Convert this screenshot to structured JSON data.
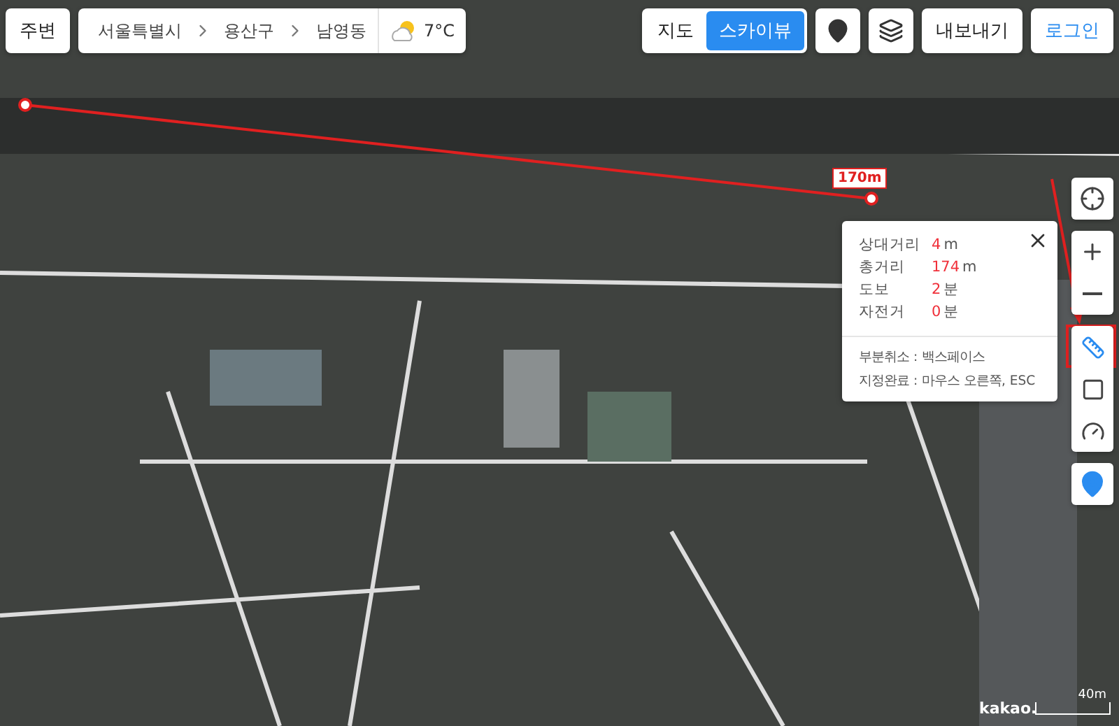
{
  "top_bar": {
    "nearby_button": "주변",
    "breadcrumb": [
      "서울특별시",
      "용산구",
      "남영동"
    ],
    "weather": {
      "temperature": "7°C"
    }
  },
  "map_types": [
    {
      "label": "지도",
      "selected": false
    },
    {
      "label": "스카이뷰",
      "selected": true
    }
  ],
  "export_button": "내보내기",
  "login_button": "로그인",
  "measure": {
    "segment_label": "170m",
    "rows": [
      {
        "label": "상대거리",
        "value": "4",
        "unit": "m"
      },
      {
        "label": "총거리",
        "value": "174",
        "unit": "m"
      },
      {
        "label": "도보",
        "value": "2",
        "unit": "분"
      },
      {
        "label": "자전거",
        "value": "0",
        "unit": "분"
      }
    ],
    "hints": [
      "부분취소 : 백스페이스",
      "지정완료 : 마우스 오른쪽, ESC"
    ]
  },
  "tools": [
    {
      "kind": "ruler",
      "selected": true
    },
    {
      "kind": "area",
      "selected": false
    },
    {
      "kind": "radius",
      "selected": false
    }
  ],
  "footer": {
    "logo": "kakao.",
    "scale": "40m"
  }
}
